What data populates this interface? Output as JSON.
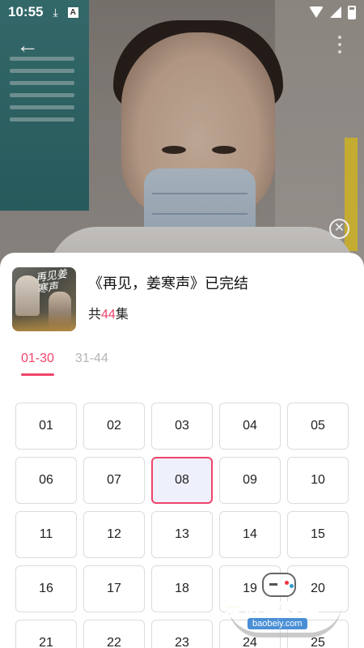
{
  "status_bar": {
    "time": "10:55",
    "notif_icons": [
      "download-icon",
      "a-app-icon"
    ],
    "system_icons": [
      "wifi-icon",
      "signal-icon",
      "battery-icon"
    ]
  },
  "player": {
    "back_icon": "arrow-left-icon",
    "more_icon": "more-vertical-icon",
    "close_icon": "close-circle-icon"
  },
  "drama": {
    "title": "《再见，姜寒声》已完结",
    "episodes_prefix": "共",
    "episodes_count": "44",
    "episodes_suffix": "集",
    "poster_title": "再见姜寒声"
  },
  "tabs": [
    {
      "label": "01-30",
      "active": true
    },
    {
      "label": "31-44",
      "active": false
    }
  ],
  "episodes": [
    "01",
    "02",
    "03",
    "04",
    "05",
    "06",
    "07",
    "08",
    "09",
    "10",
    "11",
    "12",
    "13",
    "14",
    "15",
    "16",
    "17",
    "18",
    "19",
    "20",
    "21",
    "22",
    "23",
    "24",
    "25"
  ],
  "selected_episode": "08",
  "watermark": {
    "text": "宝贝游戏网",
    "url": "baobeiy.com"
  },
  "colors": {
    "accent": "#f0446a",
    "selected_bg": "#eef0fb",
    "tab_inactive": "#b4b4b4"
  }
}
